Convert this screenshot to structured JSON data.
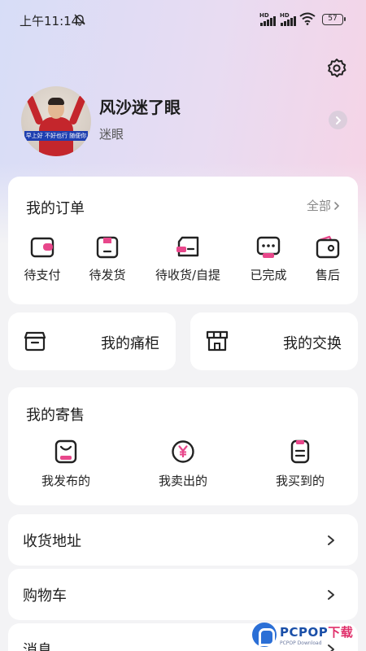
{
  "status_bar": {
    "time": "上午11:14",
    "signal_label": "HD",
    "battery": "57"
  },
  "colors": {
    "accent_pink": "#e8478b",
    "icon_dark": "#222222"
  },
  "icons": {
    "settings": "gear-icon",
    "bell_off": "bell-off-icon",
    "wifi": "wifi-icon"
  },
  "profile": {
    "username": "风沙迷了眼",
    "nickname": "迷眼",
    "avatar_caption": "早上好 不好也行 随便你"
  },
  "orders": {
    "title": "我的订单",
    "all_label": "全部",
    "items": [
      {
        "label": "待支付",
        "icon": "wallet-card-icon"
      },
      {
        "label": "待发货",
        "icon": "package-box-icon"
      },
      {
        "label": "待收货/自提",
        "icon": "delivery-truck-icon"
      },
      {
        "label": "已完成",
        "icon": "chat-complete-icon"
      },
      {
        "label": "售后",
        "icon": "wallet-refund-icon"
      }
    ]
  },
  "quick_cards": {
    "locker": {
      "label": "我的痛柜",
      "icon": "cabinet-box-icon"
    },
    "exchange": {
      "label": "我的交换",
      "icon": "shop-store-icon"
    }
  },
  "consignment": {
    "title": "我的寄售",
    "items": [
      {
        "label": "我发布的",
        "icon": "bag-publish-icon"
      },
      {
        "label": "我卖出的",
        "icon": "yuan-coin-icon"
      },
      {
        "label": "我买到的",
        "icon": "receipt-icon"
      }
    ]
  },
  "menu": [
    {
      "label": "收货地址"
    },
    {
      "label": "购物车"
    },
    {
      "label": "消息"
    }
  ],
  "watermark": {
    "main_prefix": "PCPOP",
    "main_suffix": "下载",
    "sub": "PCPOP Download"
  }
}
